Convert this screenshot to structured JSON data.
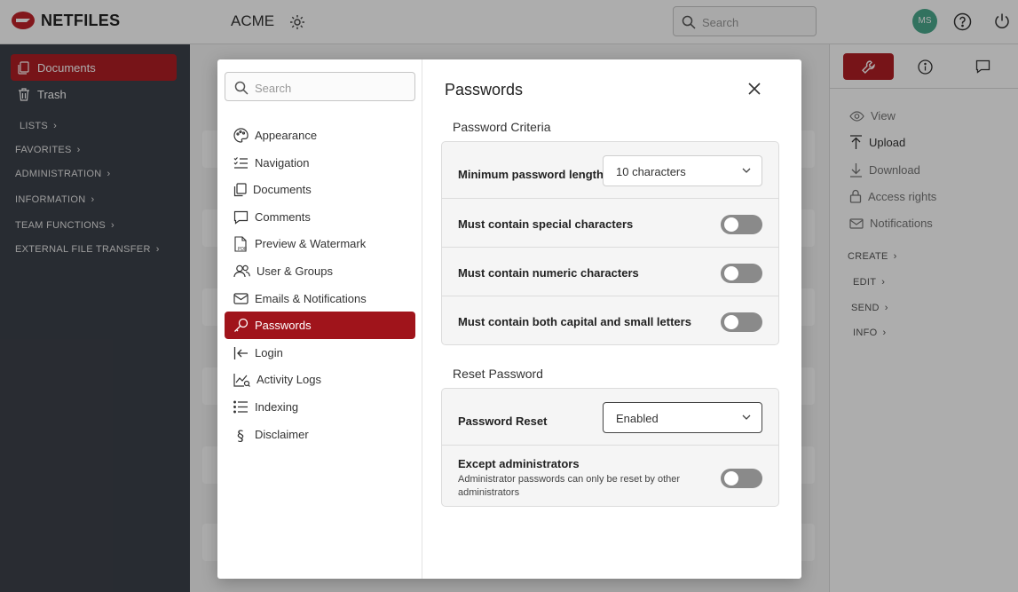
{
  "header": {
    "brand": "NETFILES",
    "workspace": "ACME",
    "search_placeholder": "Search",
    "avatar_initials": "MS"
  },
  "sidebar": {
    "items": [
      {
        "label": "Documents"
      },
      {
        "label": "Trash"
      }
    ],
    "sections": [
      "LISTS",
      "FAVORITES",
      "ADMINISTRATION",
      "INFORMATION",
      "TEAM FUNCTIONS",
      "EXTERNAL FILE TRANSFER"
    ]
  },
  "right_panel": {
    "actions": [
      {
        "label": "View"
      },
      {
        "label": "Upload"
      },
      {
        "label": "Download"
      },
      {
        "label": "Access rights"
      },
      {
        "label": "Notifications"
      }
    ],
    "sections": [
      "CREATE",
      "EDIT",
      "SEND",
      "INFO"
    ]
  },
  "modal": {
    "search_placeholder": "Search",
    "nav": [
      {
        "label": "Appearance",
        "icon": "palette-icon"
      },
      {
        "label": "Navigation",
        "icon": "checklist-icon"
      },
      {
        "label": "Documents",
        "icon": "documents-icon"
      },
      {
        "label": "Comments",
        "icon": "comment-icon"
      },
      {
        "label": "Preview & Watermark",
        "icon": "pdf-icon"
      },
      {
        "label": "User & Groups",
        "icon": "users-icon"
      },
      {
        "label": "Emails & Notifications",
        "icon": "envelope-icon"
      },
      {
        "label": "Passwords",
        "icon": "key-icon"
      },
      {
        "label": "Login",
        "icon": "login-icon"
      },
      {
        "label": "Activity Logs",
        "icon": "activity-icon"
      },
      {
        "label": "Indexing",
        "icon": "list-icon"
      },
      {
        "label": "Disclaimer",
        "icon": "section-icon"
      }
    ],
    "active_nav": "Passwords",
    "title": "Passwords",
    "criteria": {
      "title": "Password Criteria",
      "min_length_label": "Minimum password length",
      "min_length_value": "10 characters",
      "special_label": "Must contain special characters",
      "special_enabled": false,
      "numeric_label": "Must contain numeric characters",
      "numeric_enabled": false,
      "case_label": "Must contain both capital and small letters",
      "case_enabled": false
    },
    "reset": {
      "title": "Reset Password",
      "reset_label": "Password Reset",
      "reset_value": "Enabled",
      "except_label": "Except administrators",
      "except_desc": "Administrator passwords can only be reset by other administrators",
      "except_enabled": false
    }
  },
  "colors": {
    "accent": "#b01e24",
    "sidebar_bg": "#3c414a",
    "avatar": "#4aa88c"
  }
}
